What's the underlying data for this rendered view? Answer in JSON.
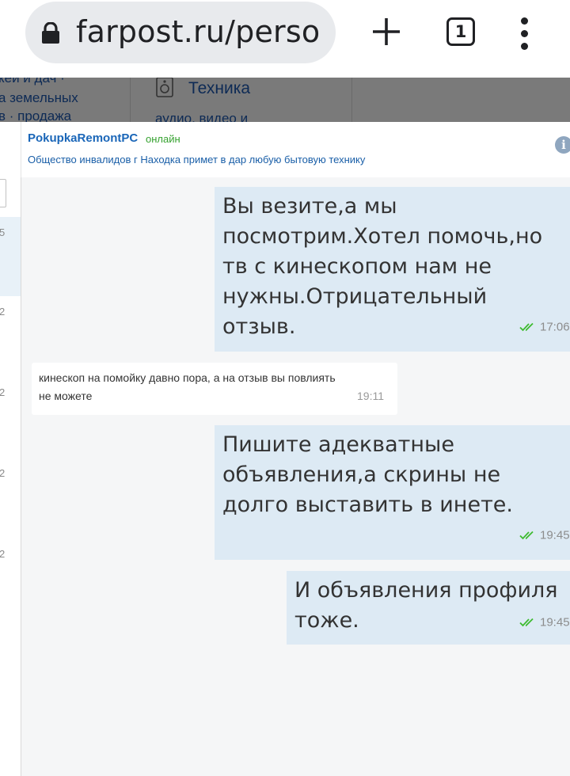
{
  "browser": {
    "url": "farpost.ru/perso",
    "tab_count": "1"
  },
  "background_page": {
    "left_lines": [
      "кей и дач ·",
      "а земельных",
      "в · продажа"
    ],
    "tech_title": "Техника",
    "tech_sub": "аудио, видео и"
  },
  "chat": {
    "contact_name": "PokupkaRemontPC",
    "status": "онлайн",
    "ad_title": "Общество инвалидов г Находка примет в дар любую бытовую технику",
    "sidebar_numbers": [
      "5",
      "2",
      "2",
      "2",
      "2"
    ],
    "messages": [
      {
        "direction": "outgoing",
        "text": "Вы везите,а мы посмотрим.Хотел помочь,но тв с кинескопом нам не нужны.Отрицательный отзыв.",
        "time": "17:06",
        "read": true
      },
      {
        "direction": "incoming",
        "text": "кинескоп на помойку давно пора, а на отзыв вы повлиять не можете",
        "time": "19:11"
      },
      {
        "direction": "outgoing",
        "text": "Пишите адекватные объявления,а скрины не долго выставить в инете.",
        "time": "19:45",
        "read": true
      },
      {
        "direction": "outgoing",
        "text": "И объявления профиля тоже.",
        "time": "19:45",
        "read": true
      }
    ]
  },
  "colors": {
    "outgoing_bubble": "#ddeaf4",
    "incoming_bubble": "#ffffff",
    "contact_name": "#1a66b8",
    "online": "#35a12f",
    "read_check": "#3dbb2f"
  }
}
